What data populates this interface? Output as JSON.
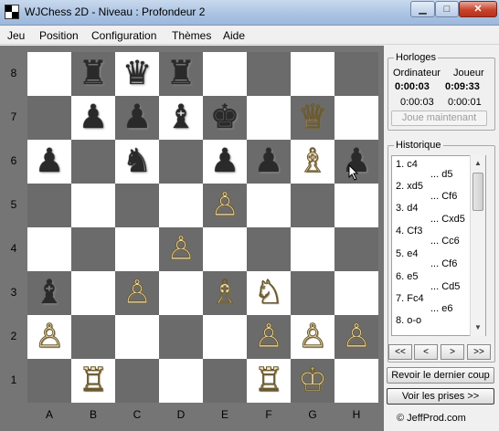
{
  "window": {
    "title": "WJChess 2D - Niveau : Profondeur 2"
  },
  "menu": {
    "items": [
      "Jeu",
      "Position",
      "Configuration",
      "Thèmes",
      "Aide"
    ]
  },
  "board": {
    "ranks": [
      "8",
      "7",
      "6",
      "5",
      "4",
      "3",
      "2",
      "1"
    ],
    "files": [
      "A",
      "B",
      "C",
      "D",
      "E",
      "F",
      "G",
      "H"
    ],
    "pieces": [
      {
        "square": "b8",
        "color": "black",
        "type": "rook",
        "glyph": "♜"
      },
      {
        "square": "c8",
        "color": "black",
        "type": "queen",
        "glyph": "♛"
      },
      {
        "square": "d8",
        "color": "black",
        "type": "rook",
        "glyph": "♜"
      },
      {
        "square": "b7",
        "color": "black",
        "type": "pawn",
        "glyph": "♟"
      },
      {
        "square": "c7",
        "color": "black",
        "type": "pawn",
        "glyph": "♟"
      },
      {
        "square": "d7",
        "color": "black",
        "type": "bishop",
        "glyph": "♝"
      },
      {
        "square": "e7",
        "color": "black",
        "type": "king",
        "glyph": "♚"
      },
      {
        "square": "g7",
        "color": "white",
        "type": "queen",
        "glyph": "♕"
      },
      {
        "square": "a6",
        "color": "black",
        "type": "pawn",
        "glyph": "♟"
      },
      {
        "square": "c6",
        "color": "black",
        "type": "knight",
        "glyph": "♞"
      },
      {
        "square": "e6",
        "color": "black",
        "type": "pawn",
        "glyph": "♟"
      },
      {
        "square": "f6",
        "color": "black",
        "type": "pawn",
        "glyph": "♟"
      },
      {
        "square": "g6",
        "color": "white",
        "type": "bishop",
        "glyph": "♗"
      },
      {
        "square": "h6",
        "color": "black",
        "type": "pawn",
        "glyph": "♟"
      },
      {
        "square": "e5",
        "color": "white",
        "type": "pawn",
        "glyph": "♙"
      },
      {
        "square": "d4",
        "color": "white",
        "type": "pawn",
        "glyph": "♙"
      },
      {
        "square": "a3",
        "color": "black",
        "type": "bishop",
        "glyph": "♝"
      },
      {
        "square": "c3",
        "color": "white",
        "type": "pawn",
        "glyph": "♙"
      },
      {
        "square": "e3",
        "color": "white",
        "type": "bishop",
        "glyph": "♗"
      },
      {
        "square": "f3",
        "color": "white",
        "type": "knight",
        "glyph": "♘"
      },
      {
        "square": "a2",
        "color": "white",
        "type": "pawn",
        "glyph": "♙"
      },
      {
        "square": "f2",
        "color": "white",
        "type": "pawn",
        "glyph": "♙"
      },
      {
        "square": "g2",
        "color": "white",
        "type": "pawn",
        "glyph": "♙"
      },
      {
        "square": "h2",
        "color": "white",
        "type": "pawn",
        "glyph": "♙"
      },
      {
        "square": "b1",
        "color": "white",
        "type": "rook",
        "glyph": "♖"
      },
      {
        "square": "f1",
        "color": "white",
        "type": "rook",
        "glyph": "♖"
      },
      {
        "square": "g1",
        "color": "white",
        "type": "king",
        "glyph": "♔"
      }
    ]
  },
  "clocks": {
    "title": "Horloges",
    "computer_label": "Ordinateur",
    "player_label": "Joueur",
    "computer_total": "0:00:03",
    "player_total": "0:09:33",
    "computer_move": "0:00:03",
    "player_move": "0:00:01",
    "play_now": "Joue maintenant"
  },
  "history": {
    "title": "Historique",
    "rows": [
      "1. c4",
      "... d5",
      "2. xd5",
      "... Cf6",
      "3. d4",
      "... Cxd5",
      "4. Cf3",
      "... Cc6",
      "5. e4",
      "... Cf6",
      "6. e5",
      "... Cd5",
      "7. Fc4",
      "... e6",
      "8. o-o"
    ]
  },
  "nav": {
    "first": "<<",
    "prev": "<",
    "next": ">",
    "last": ">>"
  },
  "buttons": {
    "review_last": "Revoir le dernier coup",
    "show_captures": "Voir les prises >>"
  },
  "footer": {
    "copyright": "© JeffProd.com"
  }
}
